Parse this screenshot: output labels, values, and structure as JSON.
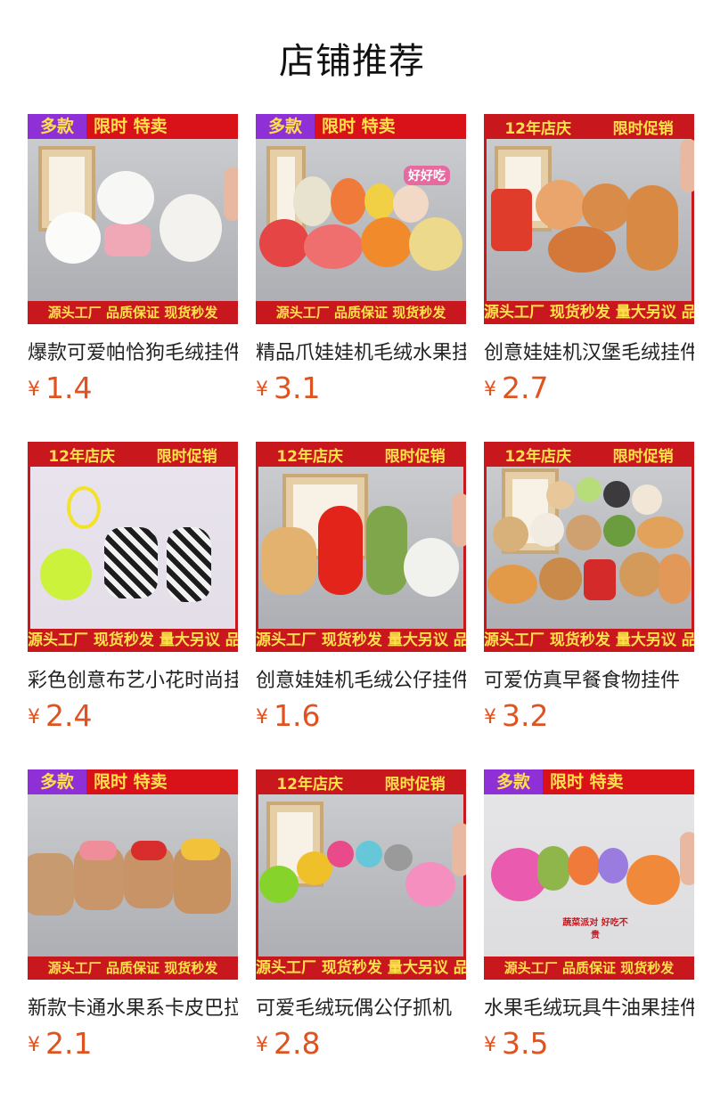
{
  "page": {
    "title": "店铺推荐"
  },
  "products": [
    {
      "name": "爆款可爱帕恰狗毛绒挂件",
      "price": "1.4",
      "currency": "¥",
      "banner_left": "多款",
      "banner_right": "限时 特卖",
      "footer": "源头工厂 品质保证 现货秒发",
      "sticker": ""
    },
    {
      "name": "精品爪娃娃机毛绒水果挂件",
      "price": "3.1",
      "currency": "¥",
      "banner_left": "多款",
      "banner_right": "限时 特卖",
      "footer": "源头工厂 品质保证 现货秒发",
      "sticker": "好好吃"
    },
    {
      "name": "创意娃娃机汉堡毛绒挂件",
      "price": "2.7",
      "currency": "¥",
      "banner_left": "12年店庆",
      "banner_right": "限时促销",
      "footer": "源头工厂 现货秒发 量大另议 品质保证",
      "sticker": ""
    },
    {
      "name": "彩色创意布艺小花时尚挂件",
      "price": "2.4",
      "currency": "¥",
      "banner_left": "12年店庆",
      "banner_right": "限时促销",
      "footer": "源头工厂 现货秒发 量大另议 品质保证",
      "sticker": ""
    },
    {
      "name": "创意娃娃机毛绒公仔挂件",
      "price": "1.6",
      "currency": "¥",
      "banner_left": "12年店庆",
      "banner_right": "限时促销",
      "footer": "源头工厂 现货秒发 量大另议 品质保证",
      "sticker": ""
    },
    {
      "name": "可爱仿真早餐食物挂件",
      "price": "3.2",
      "currency": "¥",
      "banner_left": "12年店庆",
      "banner_right": "限时促销",
      "footer": "源头工厂 现货秒发 量大另议 品质保证",
      "sticker": ""
    },
    {
      "name": "新款卡通水果系卡皮巴拉",
      "price": "2.1",
      "currency": "¥",
      "banner_left": "多款",
      "banner_right": "限时 特卖",
      "footer": "源头工厂 品质保证 现货秒发",
      "sticker": ""
    },
    {
      "name": "可爱毛绒玩偶公仔抓机",
      "price": "2.8",
      "currency": "¥",
      "banner_left": "12年店庆",
      "banner_right": "限时促销",
      "footer": "源头工厂 现货秒发 量大另议 品质保证",
      "sticker": ""
    },
    {
      "name": "水果毛绒玩具牛油果挂件",
      "price": "3.5",
      "currency": "¥",
      "banner_left": "多款",
      "banner_right": "限时 特卖",
      "footer": "源头工厂 品质保证 现货秒发",
      "sticker": "蔬菜派对 好吃不贵"
    }
  ],
  "colors": {
    "price": "#e0531f",
    "banner_purple": "#8e2fd8",
    "banner_red": "#d81218",
    "banner_text": "#ffe14a"
  }
}
